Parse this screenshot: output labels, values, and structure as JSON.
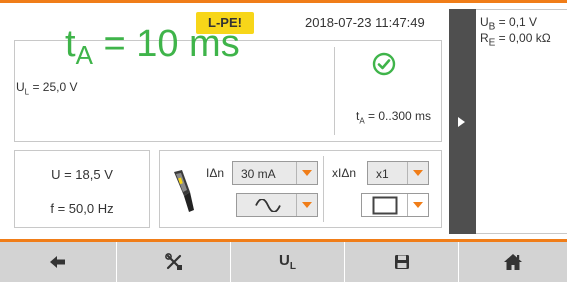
{
  "header": {
    "badge": "L-PE!",
    "datetime": "2018-07-23 11:47:49"
  },
  "result": {
    "main_symbol": "t",
    "main_subscript": "A",
    "main_value": " = 10 ms",
    "ul_symbol": "U",
    "ul_subscript": "L",
    "ul_value": " = 25,0 V",
    "limit_symbol": "t",
    "limit_subscript": "A",
    "limit_value": " = 0..300 ms",
    "status_icon": "check-circle-icon"
  },
  "measurements": {
    "voltage": "U = 18,5 V",
    "frequency": "f = 50,0 Hz"
  },
  "settings": {
    "idn_label": "IΔn",
    "idn_value": "30 mA",
    "xidn_label": "xIΔn",
    "xidn_value": "x1",
    "waveform_icon": "sine-wave-icon",
    "type_icon": "square-icon"
  },
  "sidebar": {
    "ub_symbol": "U",
    "ub_subscript": "B",
    "ub_value": " = 0,1 V",
    "re_symbol": "R",
    "re_subscript": "E",
    "re_value": " = 0,00 kΩ",
    "expand_icon": "triangle-right-icon"
  },
  "bottom_bar": {
    "buttons": [
      "back-arrow-icon",
      "tools-icon",
      "ul-button",
      "save-icon",
      "home-icon"
    ],
    "ul_symbol": "U",
    "ul_subscript": "L"
  },
  "colors": {
    "accent": "#f07d18",
    "result_green": "#3fb44a",
    "badge_yellow": "#f7d619"
  }
}
